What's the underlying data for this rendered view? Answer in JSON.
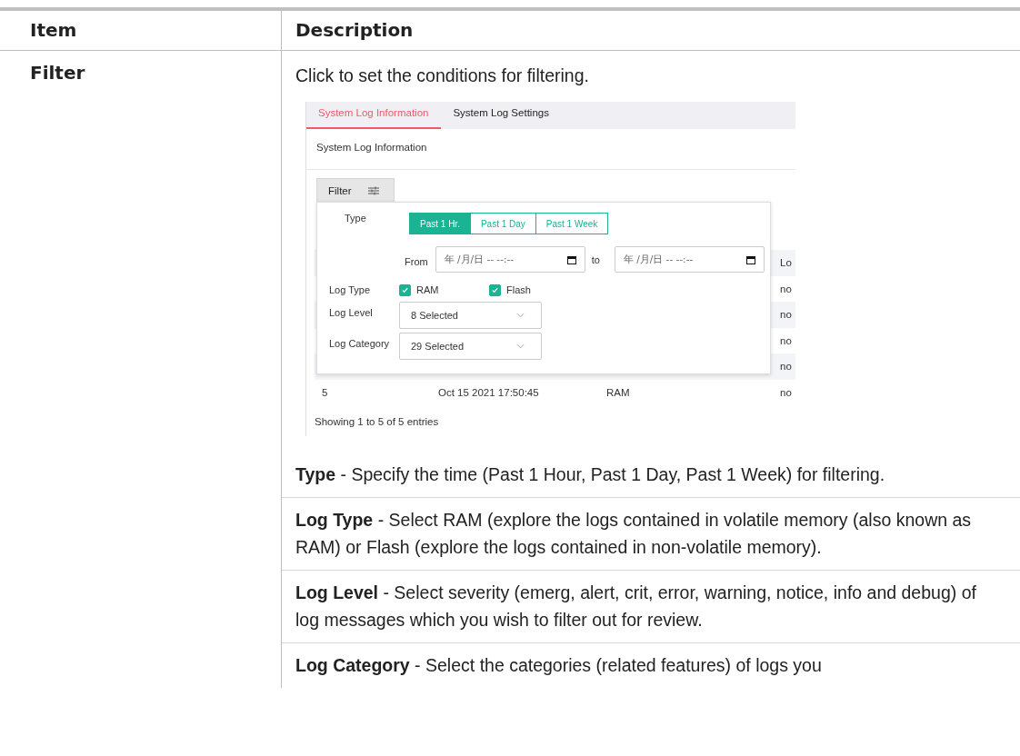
{
  "table": {
    "columns": [
      "Item",
      "Description"
    ],
    "rows": [
      {
        "item": "Filter",
        "intro": "Click to set the conditions for filtering.",
        "screenshot": {
          "tabs": [
            {
              "label": "System Log Information",
              "selected": true
            },
            {
              "label": "System Log Settings",
              "selected": false
            }
          ],
          "heading": "System Log Information",
          "filter_button": "Filter",
          "log_table": {
            "header": {
              "column_4": "Lo"
            },
            "rows": [
              {
                "column_4": "no"
              },
              {
                "column_4": "no"
              },
              {
                "column_4": "no"
              },
              {
                "column_4": "no"
              },
              {
                "column_1": "5",
                "column_2": "Oct 15 2021 17:50:45",
                "column_3": "RAM",
                "column_4": "no"
              }
            ]
          },
          "entries": "Showing 1 to 5 of 5 entries",
          "panel": {
            "type_label": "Type",
            "ranges": [
              {
                "label": "Past 1 Hr.",
                "selected": true
              },
              {
                "label": "Past 1 Day",
                "selected": false
              },
              {
                "label": "Past 1 Week",
                "selected": false
              }
            ],
            "from_label": "From",
            "from_placeholder": "年 /月/日 -- --:--",
            "to_label": "to",
            "to_placeholder": "年 /月/日 -- --:--",
            "log_type": {
              "label": "Log Type",
              "options": [
                {
                  "label": "RAM",
                  "checked": true
                },
                {
                  "label": "Flash",
                  "checked": true
                }
              ]
            },
            "log_level": {
              "label": "Log Level",
              "value": "8 Selected"
            },
            "log_category": {
              "label": "Log Category",
              "value": "29 Selected"
            }
          }
        },
        "paragraphs": [
          "**Type** - Specify the time (Past 1 Hour, Past 1 Day, Past 1 Week) for filtering.",
          "**Log Type** - Select RAM (explore the logs contained in volatile memory (also known as RAM) or Flash (explore the logs contained in non-volatile memory).",
          "**Log Level** - Select severity (emerg, alert, crit, error, warning, notice, info and debug) of log messages which you wish to filter out for review.",
          "**Log Category** - Select the categories (related features) of logs you"
        ]
      }
    ]
  }
}
